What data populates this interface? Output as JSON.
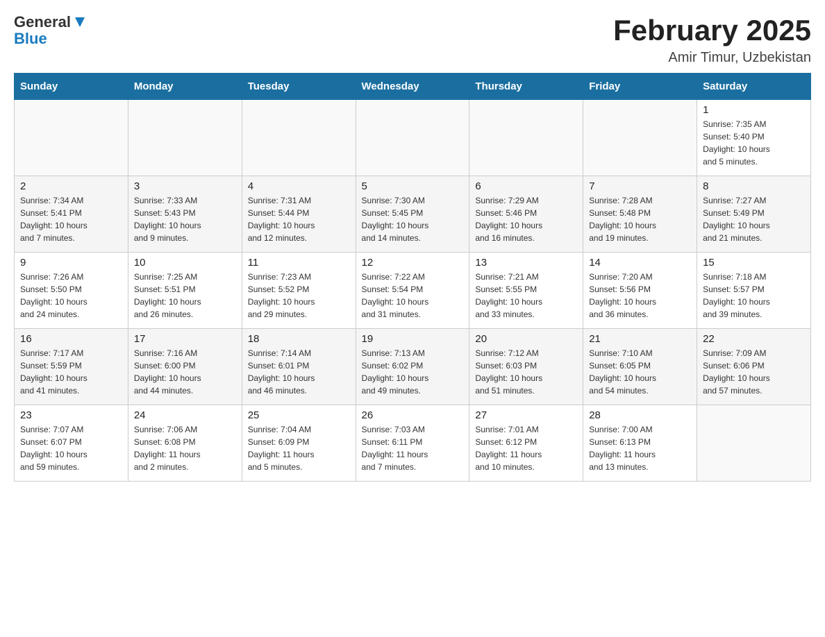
{
  "header": {
    "logo_general": "General",
    "logo_blue": "Blue",
    "month_title": "February 2025",
    "location": "Amir Timur, Uzbekistan"
  },
  "days_of_week": [
    "Sunday",
    "Monday",
    "Tuesday",
    "Wednesday",
    "Thursday",
    "Friday",
    "Saturday"
  ],
  "weeks": [
    [
      {
        "day": "",
        "info": ""
      },
      {
        "day": "",
        "info": ""
      },
      {
        "day": "",
        "info": ""
      },
      {
        "day": "",
        "info": ""
      },
      {
        "day": "",
        "info": ""
      },
      {
        "day": "",
        "info": ""
      },
      {
        "day": "1",
        "info": "Sunrise: 7:35 AM\nSunset: 5:40 PM\nDaylight: 10 hours\nand 5 minutes."
      }
    ],
    [
      {
        "day": "2",
        "info": "Sunrise: 7:34 AM\nSunset: 5:41 PM\nDaylight: 10 hours\nand 7 minutes."
      },
      {
        "day": "3",
        "info": "Sunrise: 7:33 AM\nSunset: 5:43 PM\nDaylight: 10 hours\nand 9 minutes."
      },
      {
        "day": "4",
        "info": "Sunrise: 7:31 AM\nSunset: 5:44 PM\nDaylight: 10 hours\nand 12 minutes."
      },
      {
        "day": "5",
        "info": "Sunrise: 7:30 AM\nSunset: 5:45 PM\nDaylight: 10 hours\nand 14 minutes."
      },
      {
        "day": "6",
        "info": "Sunrise: 7:29 AM\nSunset: 5:46 PM\nDaylight: 10 hours\nand 16 minutes."
      },
      {
        "day": "7",
        "info": "Sunrise: 7:28 AM\nSunset: 5:48 PM\nDaylight: 10 hours\nand 19 minutes."
      },
      {
        "day": "8",
        "info": "Sunrise: 7:27 AM\nSunset: 5:49 PM\nDaylight: 10 hours\nand 21 minutes."
      }
    ],
    [
      {
        "day": "9",
        "info": "Sunrise: 7:26 AM\nSunset: 5:50 PM\nDaylight: 10 hours\nand 24 minutes."
      },
      {
        "day": "10",
        "info": "Sunrise: 7:25 AM\nSunset: 5:51 PM\nDaylight: 10 hours\nand 26 minutes."
      },
      {
        "day": "11",
        "info": "Sunrise: 7:23 AM\nSunset: 5:52 PM\nDaylight: 10 hours\nand 29 minutes."
      },
      {
        "day": "12",
        "info": "Sunrise: 7:22 AM\nSunset: 5:54 PM\nDaylight: 10 hours\nand 31 minutes."
      },
      {
        "day": "13",
        "info": "Sunrise: 7:21 AM\nSunset: 5:55 PM\nDaylight: 10 hours\nand 33 minutes."
      },
      {
        "day": "14",
        "info": "Sunrise: 7:20 AM\nSunset: 5:56 PM\nDaylight: 10 hours\nand 36 minutes."
      },
      {
        "day": "15",
        "info": "Sunrise: 7:18 AM\nSunset: 5:57 PM\nDaylight: 10 hours\nand 39 minutes."
      }
    ],
    [
      {
        "day": "16",
        "info": "Sunrise: 7:17 AM\nSunset: 5:59 PM\nDaylight: 10 hours\nand 41 minutes."
      },
      {
        "day": "17",
        "info": "Sunrise: 7:16 AM\nSunset: 6:00 PM\nDaylight: 10 hours\nand 44 minutes."
      },
      {
        "day": "18",
        "info": "Sunrise: 7:14 AM\nSunset: 6:01 PM\nDaylight: 10 hours\nand 46 minutes."
      },
      {
        "day": "19",
        "info": "Sunrise: 7:13 AM\nSunset: 6:02 PM\nDaylight: 10 hours\nand 49 minutes."
      },
      {
        "day": "20",
        "info": "Sunrise: 7:12 AM\nSunset: 6:03 PM\nDaylight: 10 hours\nand 51 minutes."
      },
      {
        "day": "21",
        "info": "Sunrise: 7:10 AM\nSunset: 6:05 PM\nDaylight: 10 hours\nand 54 minutes."
      },
      {
        "day": "22",
        "info": "Sunrise: 7:09 AM\nSunset: 6:06 PM\nDaylight: 10 hours\nand 57 minutes."
      }
    ],
    [
      {
        "day": "23",
        "info": "Sunrise: 7:07 AM\nSunset: 6:07 PM\nDaylight: 10 hours\nand 59 minutes."
      },
      {
        "day": "24",
        "info": "Sunrise: 7:06 AM\nSunset: 6:08 PM\nDaylight: 11 hours\nand 2 minutes."
      },
      {
        "day": "25",
        "info": "Sunrise: 7:04 AM\nSunset: 6:09 PM\nDaylight: 11 hours\nand 5 minutes."
      },
      {
        "day": "26",
        "info": "Sunrise: 7:03 AM\nSunset: 6:11 PM\nDaylight: 11 hours\nand 7 minutes."
      },
      {
        "day": "27",
        "info": "Sunrise: 7:01 AM\nSunset: 6:12 PM\nDaylight: 11 hours\nand 10 minutes."
      },
      {
        "day": "28",
        "info": "Sunrise: 7:00 AM\nSunset: 6:13 PM\nDaylight: 11 hours\nand 13 minutes."
      },
      {
        "day": "",
        "info": ""
      }
    ]
  ]
}
